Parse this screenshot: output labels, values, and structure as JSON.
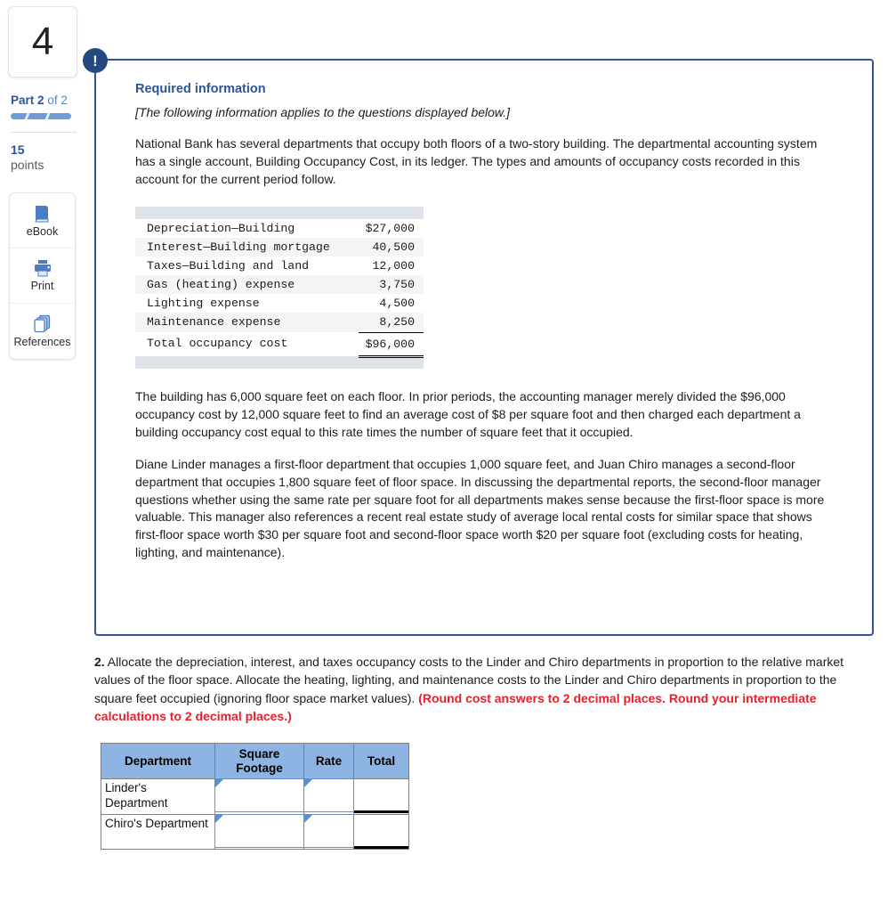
{
  "rail": {
    "question_number": "4",
    "part_prefix": "Part",
    "part_current": "2",
    "part_middle": "of",
    "part_total": "2",
    "points_value": "15",
    "points_label": "points",
    "tools": [
      {
        "label": "eBook",
        "icon": "book-icon"
      },
      {
        "label": "Print",
        "icon": "printer-icon"
      },
      {
        "label": "References",
        "icon": "pages-icon"
      }
    ]
  },
  "question_box": {
    "alert_icon": "exclamation-icon",
    "required_title": "Required information",
    "applies_note": "[The following information applies to the questions displayed below.]",
    "intro_paragraph": "National Bank has several departments that occupy both floors of a two-story building. The departmental accounting system has a single account, Building Occupancy Cost, in its ledger. The types and amounts of occupancy costs recorded in this account for the current period follow.",
    "paragraph_2": "The building has 6,000 square feet on each floor. In prior periods, the accounting manager merely divided the $96,000 occupancy cost by 12,000 square feet to find an average cost of $8 per square foot and then charged each department a building occupancy cost equal to this rate times the number of square feet that it occupied.",
    "paragraph_3": "Diane Linder manages a first-floor department that occupies 1,000 square feet, and Juan Chiro manages a second-floor department that occupies 1,800 square feet of floor space. In discussing the departmental reports, the second-floor manager questions whether using the same rate per square foot for all departments makes sense because the first-floor space is more valuable. This manager also references a recent real estate study of average local rental costs for similar space that shows first-floor space worth $30 per square foot and second-floor space worth $20 per square foot (excluding costs for heating, lighting, and maintenance)."
  },
  "cost_table": {
    "rows": [
      {
        "label": "Depreciation—Building",
        "amount": "$27,000"
      },
      {
        "label": "Interest—Building mortgage",
        "amount": "40,500"
      },
      {
        "label": "Taxes—Building and land",
        "amount": "12,000"
      },
      {
        "label": "Gas (heating) expense",
        "amount": "3,750"
      },
      {
        "label": "Lighting expense",
        "amount": "4,500"
      },
      {
        "label": "Maintenance expense",
        "amount": "8,250"
      }
    ],
    "total_label": "Total occupancy cost",
    "total_amount": "$96,000"
  },
  "question_2": {
    "number": "2.",
    "text": " Allocate the depreciation, interest, and taxes occupancy costs to the Linder and Chiro departments in proportion to the relative market values of the floor space. Allocate the heating, lighting, and maintenance costs to the Linder and Chiro departments in proportion to the square feet occupied (ignoring floor space market values). ",
    "red_note": "(Round cost answers to 2 decimal places. Round your intermediate calculations to 2 decimal places.)"
  },
  "answer_table": {
    "headers": [
      "Department",
      "Square Footage",
      "Rate",
      "Total"
    ],
    "rows": [
      {
        "department": "Linder's Department",
        "square_footage": "",
        "rate": "",
        "total": ""
      },
      {
        "department": "Chiro's Department",
        "square_footage": "",
        "rate": "",
        "total": ""
      }
    ]
  },
  "colors": {
    "accent_blue": "#2a5599",
    "box_border": "#2c5696",
    "table_header_blue": "#8db4e2",
    "red_note": "#e8202a",
    "icon_blue": "#4a7dc4"
  }
}
